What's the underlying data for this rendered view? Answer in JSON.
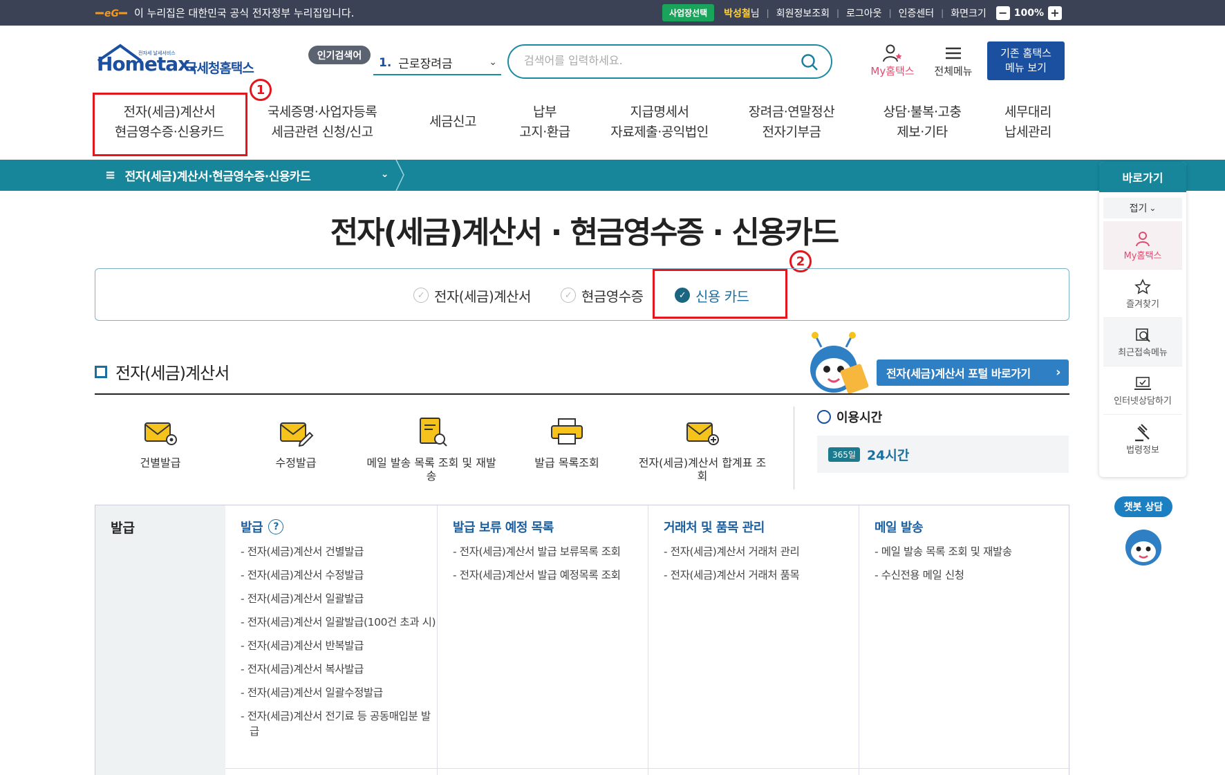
{
  "topbar": {
    "gov_notice": "이 누리집은 대한민국 공식 전자정부 누리집입니다.",
    "biz_switch": "사업장선택",
    "user_name": "박성철",
    "user_suffix": "님",
    "links": [
      "회원정보조회",
      "로그아웃",
      "인증센터",
      "화면크기"
    ],
    "zoom": "100%"
  },
  "header": {
    "logo_small": "전자세 날세서비스",
    "logo_main": "Hometax.",
    "logo_kor": "국세청홈택스",
    "popular_badge": "인기검색어",
    "popular_num": "1.",
    "popular_keyword": "근로장려금",
    "search_placeholder": "검색어를 입력하세요.",
    "my_hometax": "My홈택스",
    "all_menu": "전체메뉴",
    "old_menu_line1": "기존 홈택스",
    "old_menu_line2": "메뉴 보기"
  },
  "gnb": [
    {
      "l1": "전자(세금)계산서",
      "l2": "현금영수증·신용카드"
    },
    {
      "l1": "국세증명·사업자등록",
      "l2": "세금관련 신청/신고"
    },
    {
      "l1": "세금신고",
      "l2": ""
    },
    {
      "l1": "납부",
      "l2": "고지·환급"
    },
    {
      "l1": "지급명세서",
      "l2": "자료제출·공익법인"
    },
    {
      "l1": "장려금·연말정산",
      "l2": "전자기부금"
    },
    {
      "l1": "상담·불복·고충",
      "l2": "제보·기타"
    },
    {
      "l1": "세무대리",
      "l2": "납세관리"
    }
  ],
  "annotations": {
    "one": "1",
    "two": "2"
  },
  "subbar": {
    "menu_label": "전자(세금)계산서·현금영수증·신용카드"
  },
  "page_title": "전자(세금)계산서 · 현금영수증 · 신용카드",
  "tabs": [
    "전자(세금)계산서",
    "현금영수증",
    "신용 카드"
  ],
  "section": {
    "title": "전자(세금)계산서",
    "portal_button": "전자(세금)계산서 포털 바로가기"
  },
  "quick_icons": [
    {
      "label": "건별발급",
      "icon": "envelope-gear-icon"
    },
    {
      "label": "수정발급",
      "icon": "envelope-edit-icon"
    },
    {
      "label": "메일 발송 목록 조회 및 재발송",
      "icon": "document-search-icon"
    },
    {
      "label": "발급 목록조회",
      "icon": "printer-icon"
    },
    {
      "label": "전자(세금)계산서 합계표 조회",
      "icon": "envelope-plus-icon"
    }
  ],
  "usage": {
    "label": "이용시간",
    "badge": "365일",
    "hours": "24시간"
  },
  "menu": {
    "category": "발급",
    "columns": [
      {
        "header": "발급",
        "help": "?",
        "items": [
          "- 전자(세금)계산서 건별발급",
          "- 전자(세금)계산서 수정발급",
          "- 전자(세금)계산서 일괄발급",
          "- 전자(세금)계산서 일괄발급(100건 초과 시)",
          "- 전자(세금)계산서 반복발급",
          "- 전자(세금)계산서 복사발급",
          "- 전자(세금)계산서 일괄수정발급",
          "- 전자(세금)계산서 전기료 등 공동매입분 발급"
        ]
      },
      {
        "header": "발급 보류 예정 목록",
        "items": [
          "- 전자(세금)계산서 발급 보류목록 조회",
          "- 전자(세금)계산서 발급 예정목록 조회"
        ]
      },
      {
        "header": "거래처 및 품목 관리",
        "items": [
          "- 전자(세금)계산서 거래처 관리",
          "- 전자(세금)계산서 거래처 품목"
        ]
      },
      {
        "header": "메일 발송",
        "items": [
          "- 메일 발송 목록 조회 및 재발송",
          "- 수신전용 메일 신청"
        ]
      }
    ]
  },
  "quick_panel": {
    "title": "바로가기",
    "fold": "접기",
    "items": [
      "My홈택스",
      "즐겨찾기",
      "최근접속메뉴",
      "인터넷상담하기",
      "법령정보"
    ]
  },
  "chatbot": "챗봇 상담",
  "colors": {
    "teal": "#17869a",
    "navy": "#1b4fa0",
    "red_annotation": "#e2161c",
    "topbar": "#3b4256"
  }
}
